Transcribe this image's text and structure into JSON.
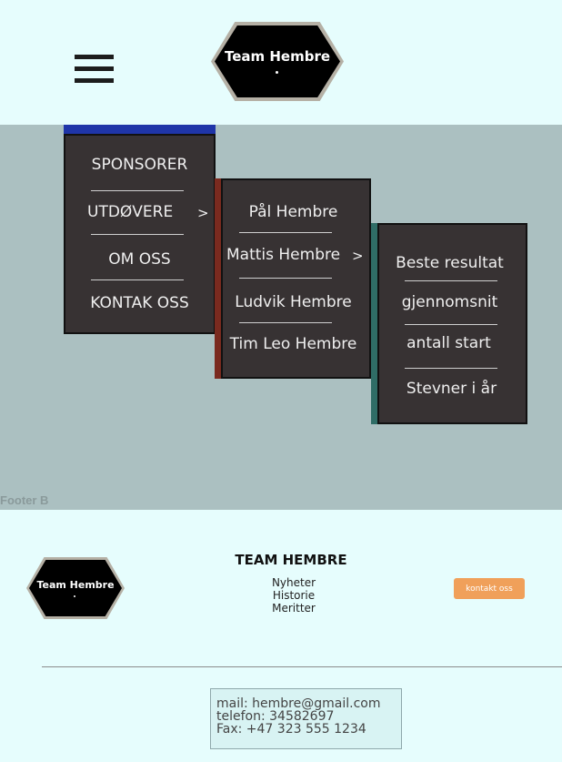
{
  "header": {
    "menu_icon": "hamburger-menu-icon",
    "logo_text": "Team Hembre"
  },
  "menu": {
    "level1": {
      "accent_color": "#1f35a8",
      "items": [
        {
          "label": "SPONSORER"
        },
        {
          "label": "UTDØVERE",
          "submenu_indicator": ">"
        },
        {
          "label": "OM OSS"
        },
        {
          "label": "KONTAK OSS"
        }
      ]
    },
    "level2": {
      "accent_color": "#7a2a1f",
      "items": [
        {
          "label": "Pål Hembre"
        },
        {
          "label": "Mattis Hembre",
          "submenu_indicator": ">"
        },
        {
          "label": "Ludvik Hembre"
        },
        {
          "label": "Tim Leo Hembre"
        }
      ]
    },
    "level3": {
      "accent_color": "#2f6d66",
      "items": [
        {
          "label": "Beste resultat"
        },
        {
          "label": "gjennomsnit"
        },
        {
          "label": "antall start"
        },
        {
          "label": "Stevner i år"
        }
      ]
    }
  },
  "footer_section_label": "Footer B",
  "footer": {
    "logo_text": "Team Hembre",
    "title": "TEAM HEMBRE",
    "links": [
      "Nyheter",
      "Historie",
      "Meritter"
    ],
    "contact_button": "kontakt oss",
    "contact": {
      "mail": "mail: hembre@gmail.com",
      "phone": "telefon:  34582697",
      "fax": "Fax: +47 323 555 1234"
    }
  },
  "colors": {
    "page_bg": "#e6fdfd",
    "menu_area_bg": "#abc0c1",
    "panel_bg": "#373233",
    "button_orange": "#f0a05a"
  }
}
